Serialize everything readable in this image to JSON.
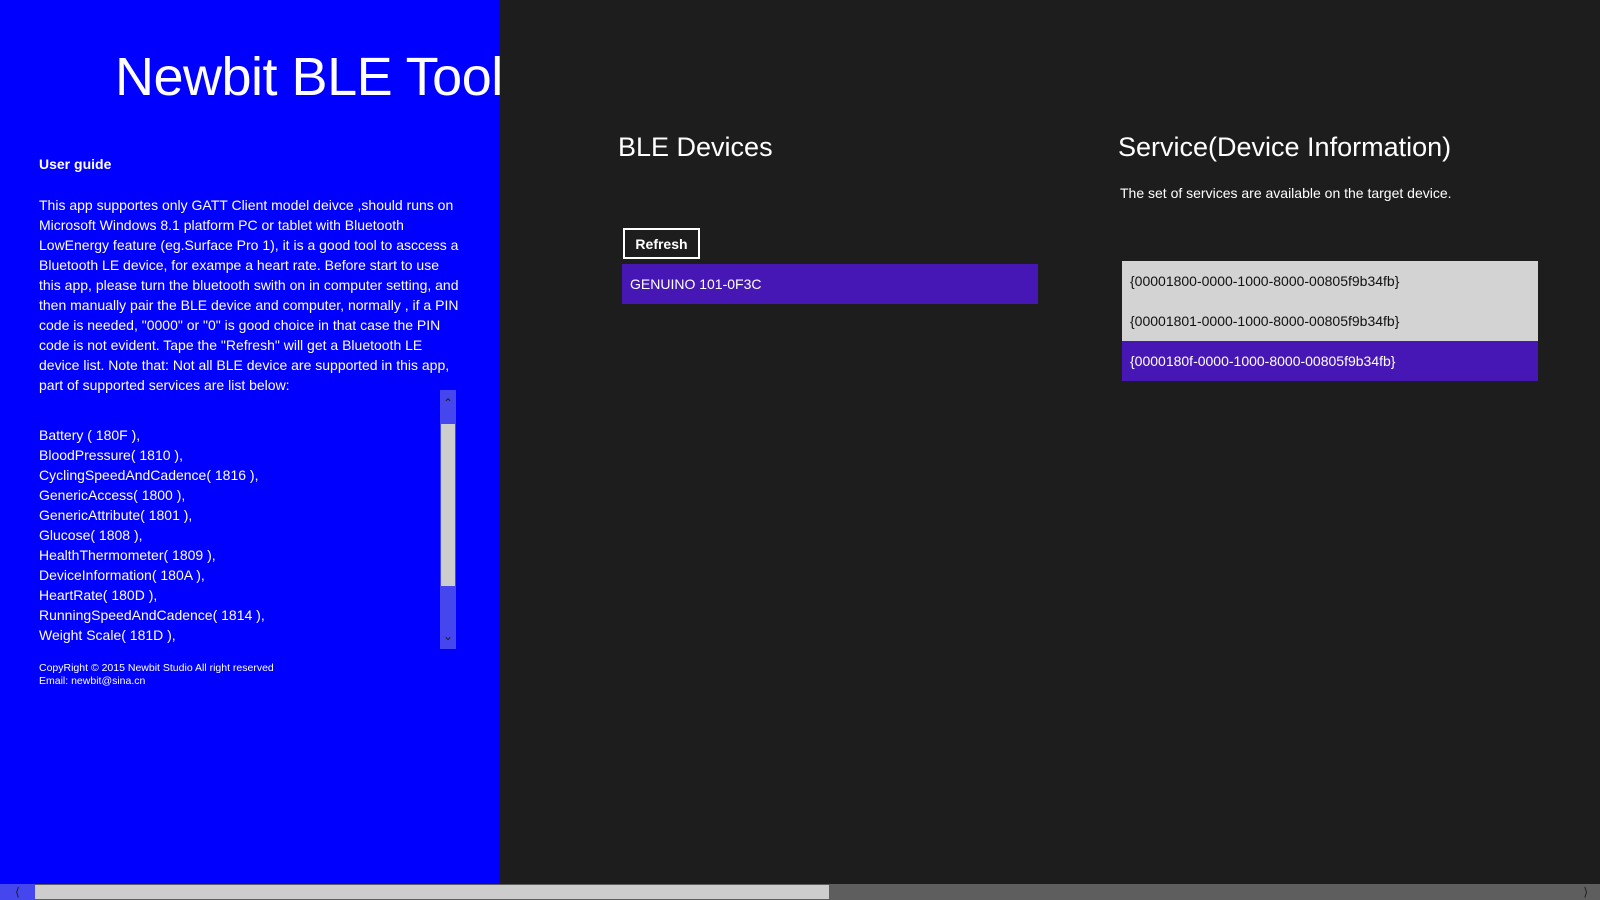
{
  "app": {
    "title": "Newbit BLE Tool"
  },
  "guide": {
    "title": "User guide",
    "body": "This app supportes only GATT Client model deivce ,should runs on Microsoft Windows 8.1 platform PC or tablet with Bluetooth LowEnergy feature (eg.Surface Pro 1), it is a good tool to asccess a Bluetooth LE device, for exampe a heart rate.  Before start to use this app, please turn the bluetooth swith on in computer setting, and then manually pair the BLE device and computer, normally , if a PIN  code is needed, \"0000\" or \"0\"  is good choice in that case the PIN code is not evident.  Tape the \"Refresh\" will get a Bluetooth LE device list.  Note that: Not all BLE device are supported in this app, part of supported services are list below:",
    "services": [
      "Battery ( 180F ),",
      "BloodPressure( 1810 ),",
      "CyclingSpeedAndCadence( 1816 ),",
      "GenericAccess( 1800 ),",
      "GenericAttribute( 1801 ),",
      "Glucose( 1808 ),",
      "HealthThermometer( 1809 ),",
      "DeviceInformation( 180A ),",
      "HeartRate( 180D ),",
      "RunningSpeedAndCadence( 1814 ),",
      "Weight Scale( 181D ),"
    ],
    "copyright": "CopyRight © 2015 Newbit Studio All right reserved",
    "email": "Email: newbit@sina.cn"
  },
  "devices": {
    "title": "BLE Devices",
    "refresh_label": "Refresh",
    "items": [
      "GENUINO 101-0F3C"
    ]
  },
  "service_panel": {
    "title": "Service(Device Information)",
    "description": "The set of services are available on the target device.",
    "items": [
      "{00001800-0000-1000-8000-00805f9b34fb}",
      "{00001801-0000-1000-8000-00805f9b34fb}",
      "{0000180f-0000-1000-8000-00805f9b34fb}"
    ],
    "selected_index": 2
  },
  "colors": {
    "left_panel": "#0000ff",
    "background": "#1d1d1d",
    "selection": "#4617b4"
  },
  "icons": {
    "scroll_up": "chevron-up-icon",
    "scroll_down": "chevron-down-icon",
    "scroll_left": "chevron-left-icon",
    "scroll_right": "chevron-right-icon"
  }
}
